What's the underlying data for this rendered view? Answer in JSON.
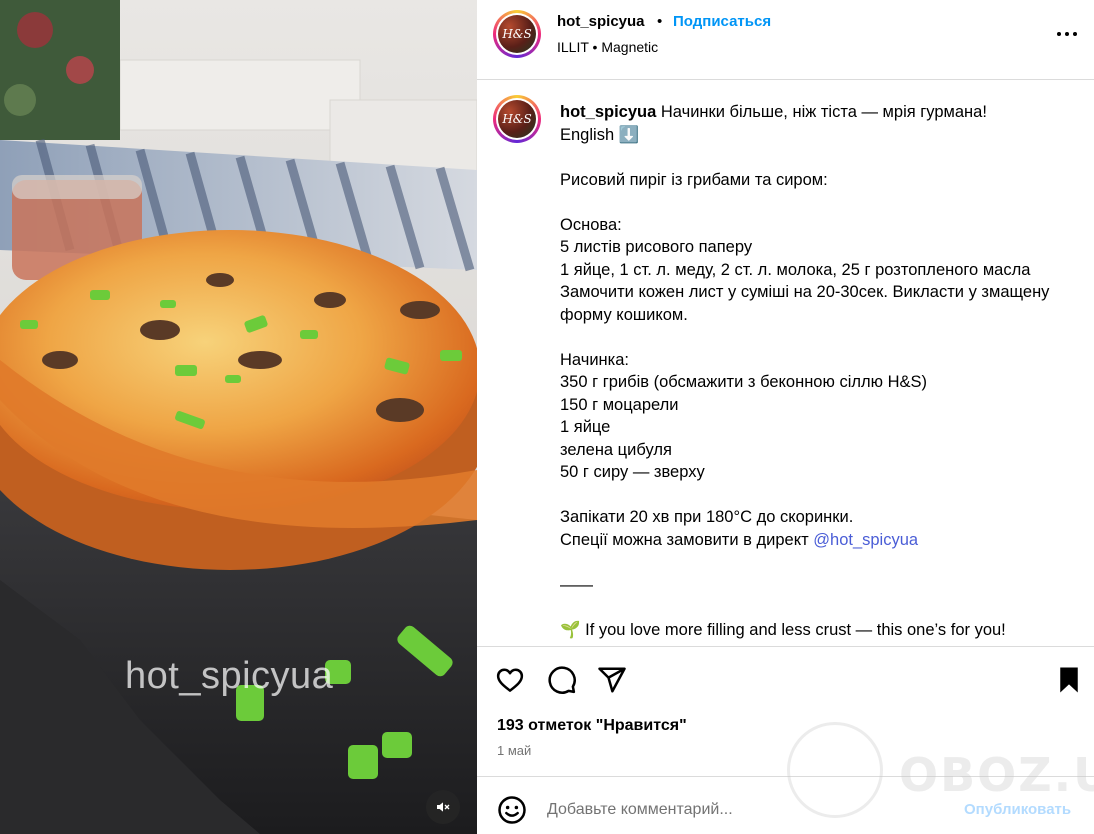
{
  "media": {
    "watermark": "hot_spicyua",
    "mute_icon": "speaker-muted-icon"
  },
  "header": {
    "username": "hot_spicyua",
    "separator": "•",
    "follow_label": "Подписаться",
    "music": "ILLIT • Magnetic",
    "avatar_text": "H&S",
    "more_icon": "more-horizontal-icon"
  },
  "caption": {
    "username": "hot_spicyua",
    "text_1": "Начинки більше, ніж тіста — мрія гурмана!\nEnglish ⬇️\n\nРисовий пиріг із грибами та сиром:\n\nОснова:\n5 листів рисового паперу\n1 яйце, 1 ст. л. меду, 2 ст. л. молока, 25 г розтопленого масла\nЗамочити кожен лист у суміші на 20-30сек. Викласти у змащену форму кошиком.\n\nНачинка:\n350 г грибів (обсмажити з беконною сіллю H&S)\n150 г моцарели\n1 яйце\nзелена цибуля\n50 г сиру — зверху\n\nЗапікати 20 хв при 180°C до скоринки.\nСпеції можна замовити в директ ",
    "mention": "@hot_spicyua",
    "text_2": "\n\n——\n\n🌱 If you love more filling and less crust — this one’s for you!"
  },
  "actions": {
    "likes": "193 отметок \"Нравится\"",
    "date": "1 май",
    "icons": [
      "heart-icon",
      "comment-icon",
      "share-icon",
      "bookmark-icon"
    ]
  },
  "comment": {
    "placeholder": "Добавьте комментарий...",
    "post_label": "Опубликовать",
    "emoji_icon": "emoji-icon"
  },
  "site_watermark": "OBOZ.UA"
}
